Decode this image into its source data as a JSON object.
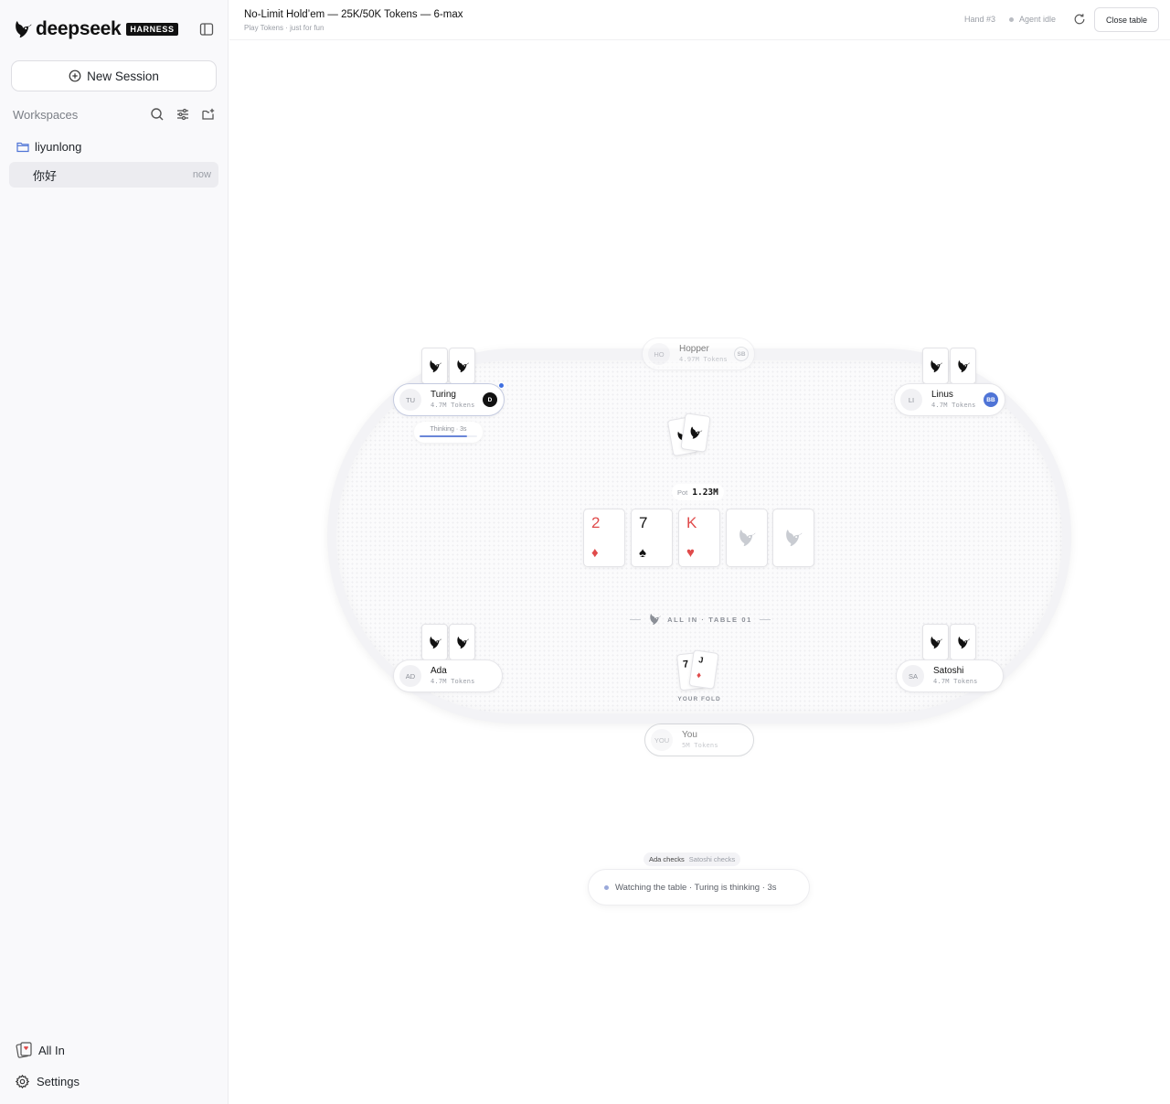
{
  "sidebar": {
    "brand": {
      "name": "deepseek",
      "badge": "HARNESS"
    },
    "new_session_label": "New Session",
    "workspaces_label": "Workspaces",
    "folder_name": "liyunlong",
    "sessions": [
      {
        "title": "你好",
        "time": "now"
      }
    ],
    "bottom": {
      "all_in_label": "All In",
      "settings_label": "Settings"
    }
  },
  "topbar": {
    "title": "No-Limit Hold’em — 25K/50K Tokens — 6-max",
    "subtitle": "Play Tokens · just for fun",
    "hand": "Hand #3",
    "agent_status": "Agent idle",
    "close_label": "Close table"
  },
  "table": {
    "seats": [
      {
        "key": "hopper",
        "initials": "HO",
        "name": "Hopper",
        "stack": "4.97M Tokens",
        "badge": "SB",
        "state": "folded"
      },
      {
        "key": "turing",
        "initials": "TU",
        "name": "Turing",
        "stack": "4.7M Tokens",
        "badge": "D",
        "state": "acting"
      },
      {
        "key": "linus",
        "initials": "LI",
        "name": "Linus",
        "stack": "4.7M Tokens",
        "badge": "BB",
        "state": "in-hand"
      },
      {
        "key": "ada",
        "initials": "AD",
        "name": "Ada",
        "stack": "4.7M Tokens",
        "badge": "",
        "state": "in-hand"
      },
      {
        "key": "satoshi",
        "initials": "SA",
        "name": "Satoshi",
        "stack": "4.7M Tokens",
        "badge": "",
        "state": "in-hand"
      },
      {
        "key": "you",
        "initials": "YOU",
        "name": "You",
        "stack": "5M Tokens",
        "badge": "",
        "state": "folded"
      }
    ],
    "thinking": {
      "label": "Thinking · 3s",
      "progress": 0.82
    },
    "pot": {
      "label": "Pot",
      "value": "1.23M"
    },
    "board": [
      {
        "rank": "2",
        "suit": "♦",
        "color": "red"
      },
      {
        "rank": "7",
        "suit": "♠",
        "color": "black"
      },
      {
        "rank": "K",
        "suit": "♥",
        "color": "red"
      },
      {
        "rank": "",
        "suit": "",
        "color": "empty"
      },
      {
        "rank": "",
        "suit": "",
        "color": "empty"
      }
    ],
    "watermark": "ALL IN · TABLE 01",
    "your_fold": {
      "label": "YOUR FOLD",
      "cards": [
        "7",
        "J"
      ],
      "card2_suit": "♦"
    }
  },
  "log": {
    "recent": "Ada checks",
    "previous": "Satoshi checks"
  },
  "status": "Watching the table · Turing is thinking · 3s",
  "colors": {
    "accent": "#3f6fe0",
    "red_suit": "#e04b4b",
    "big_blind": "#4f74d6"
  }
}
